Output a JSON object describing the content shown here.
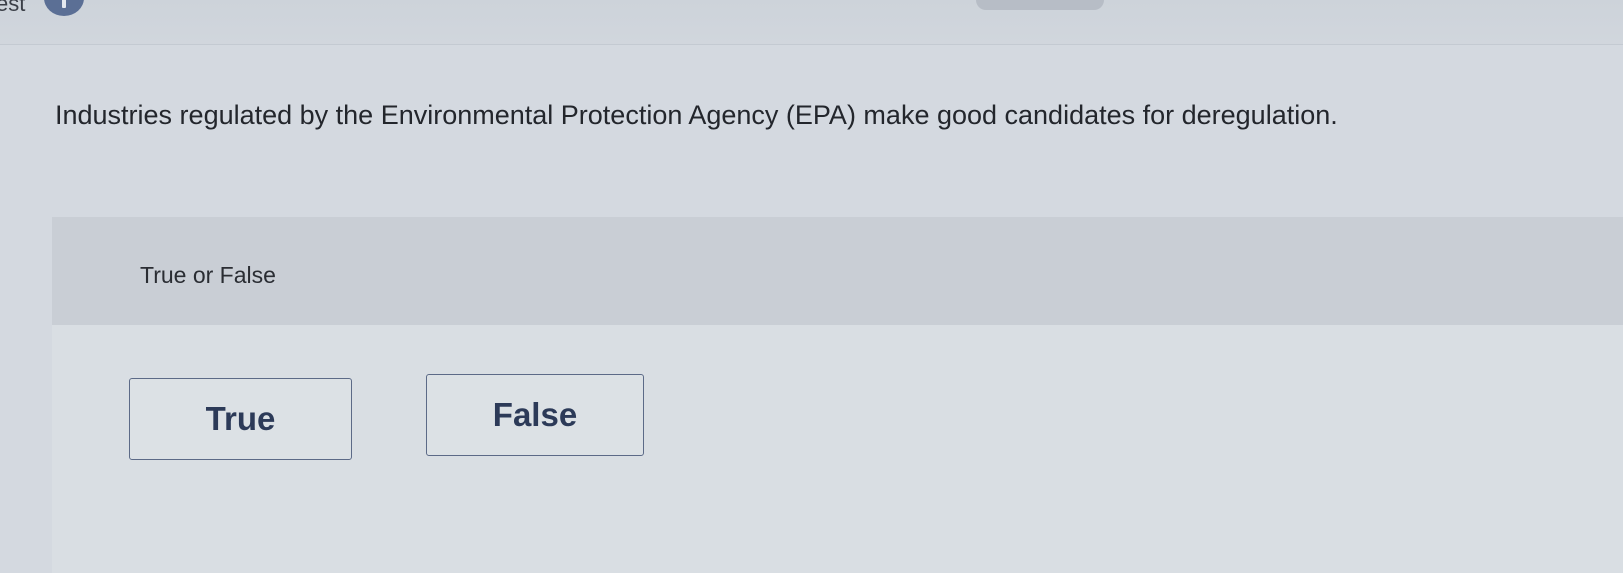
{
  "header": {
    "partial_text": "est",
    "info_icon": "info-icon"
  },
  "question": {
    "prompt": "Industries regulated by the Environmental Protection Agency (EPA) make good candidates for deregulation.",
    "answer_type": "True or False"
  },
  "choices": [
    {
      "label": "True"
    },
    {
      "label": "False"
    }
  ],
  "colors": {
    "background": "#d4d9e0",
    "header_band": "#c9ced5",
    "choice_border": "#5c6a87",
    "choice_text": "#2c3a58",
    "info_badge": "#5b6f95"
  }
}
